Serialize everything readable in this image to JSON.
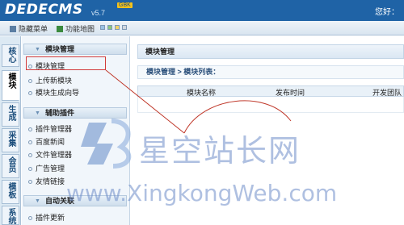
{
  "header": {
    "logo": "DEDECMS",
    "version": "v5.7",
    "badge": "GBK",
    "greeting": "您好："
  },
  "toolbar": {
    "hide_menu": "隐藏菜单",
    "site_map": "功能地图"
  },
  "left_tabs": [
    "核心",
    "模块",
    "生成",
    "采集",
    "会员",
    "模板",
    "系统"
  ],
  "menu": {
    "group1": "模块管理",
    "group1_items": [
      "模块管理",
      "上传新模块",
      "模块生成向导"
    ],
    "group2": "辅助插件",
    "group2_items": [
      "插件管理器",
      "百度新闻",
      "文件管理器",
      "广告管理",
      "友情链接"
    ],
    "group3": "自动关联",
    "group3_items": [
      "插件更新"
    ]
  },
  "content": {
    "title": "模块管理",
    "breadcrumb": "模块管理 > 模块列表：",
    "columns": [
      "模块名称",
      "发布时间",
      "开发团队"
    ]
  },
  "watermark": {
    "cn": "星空站长网",
    "en": "www.XingkongWeb.com"
  },
  "colors": {
    "header_bg": "#1f63a6",
    "highlight_red": "#d23c3c"
  }
}
